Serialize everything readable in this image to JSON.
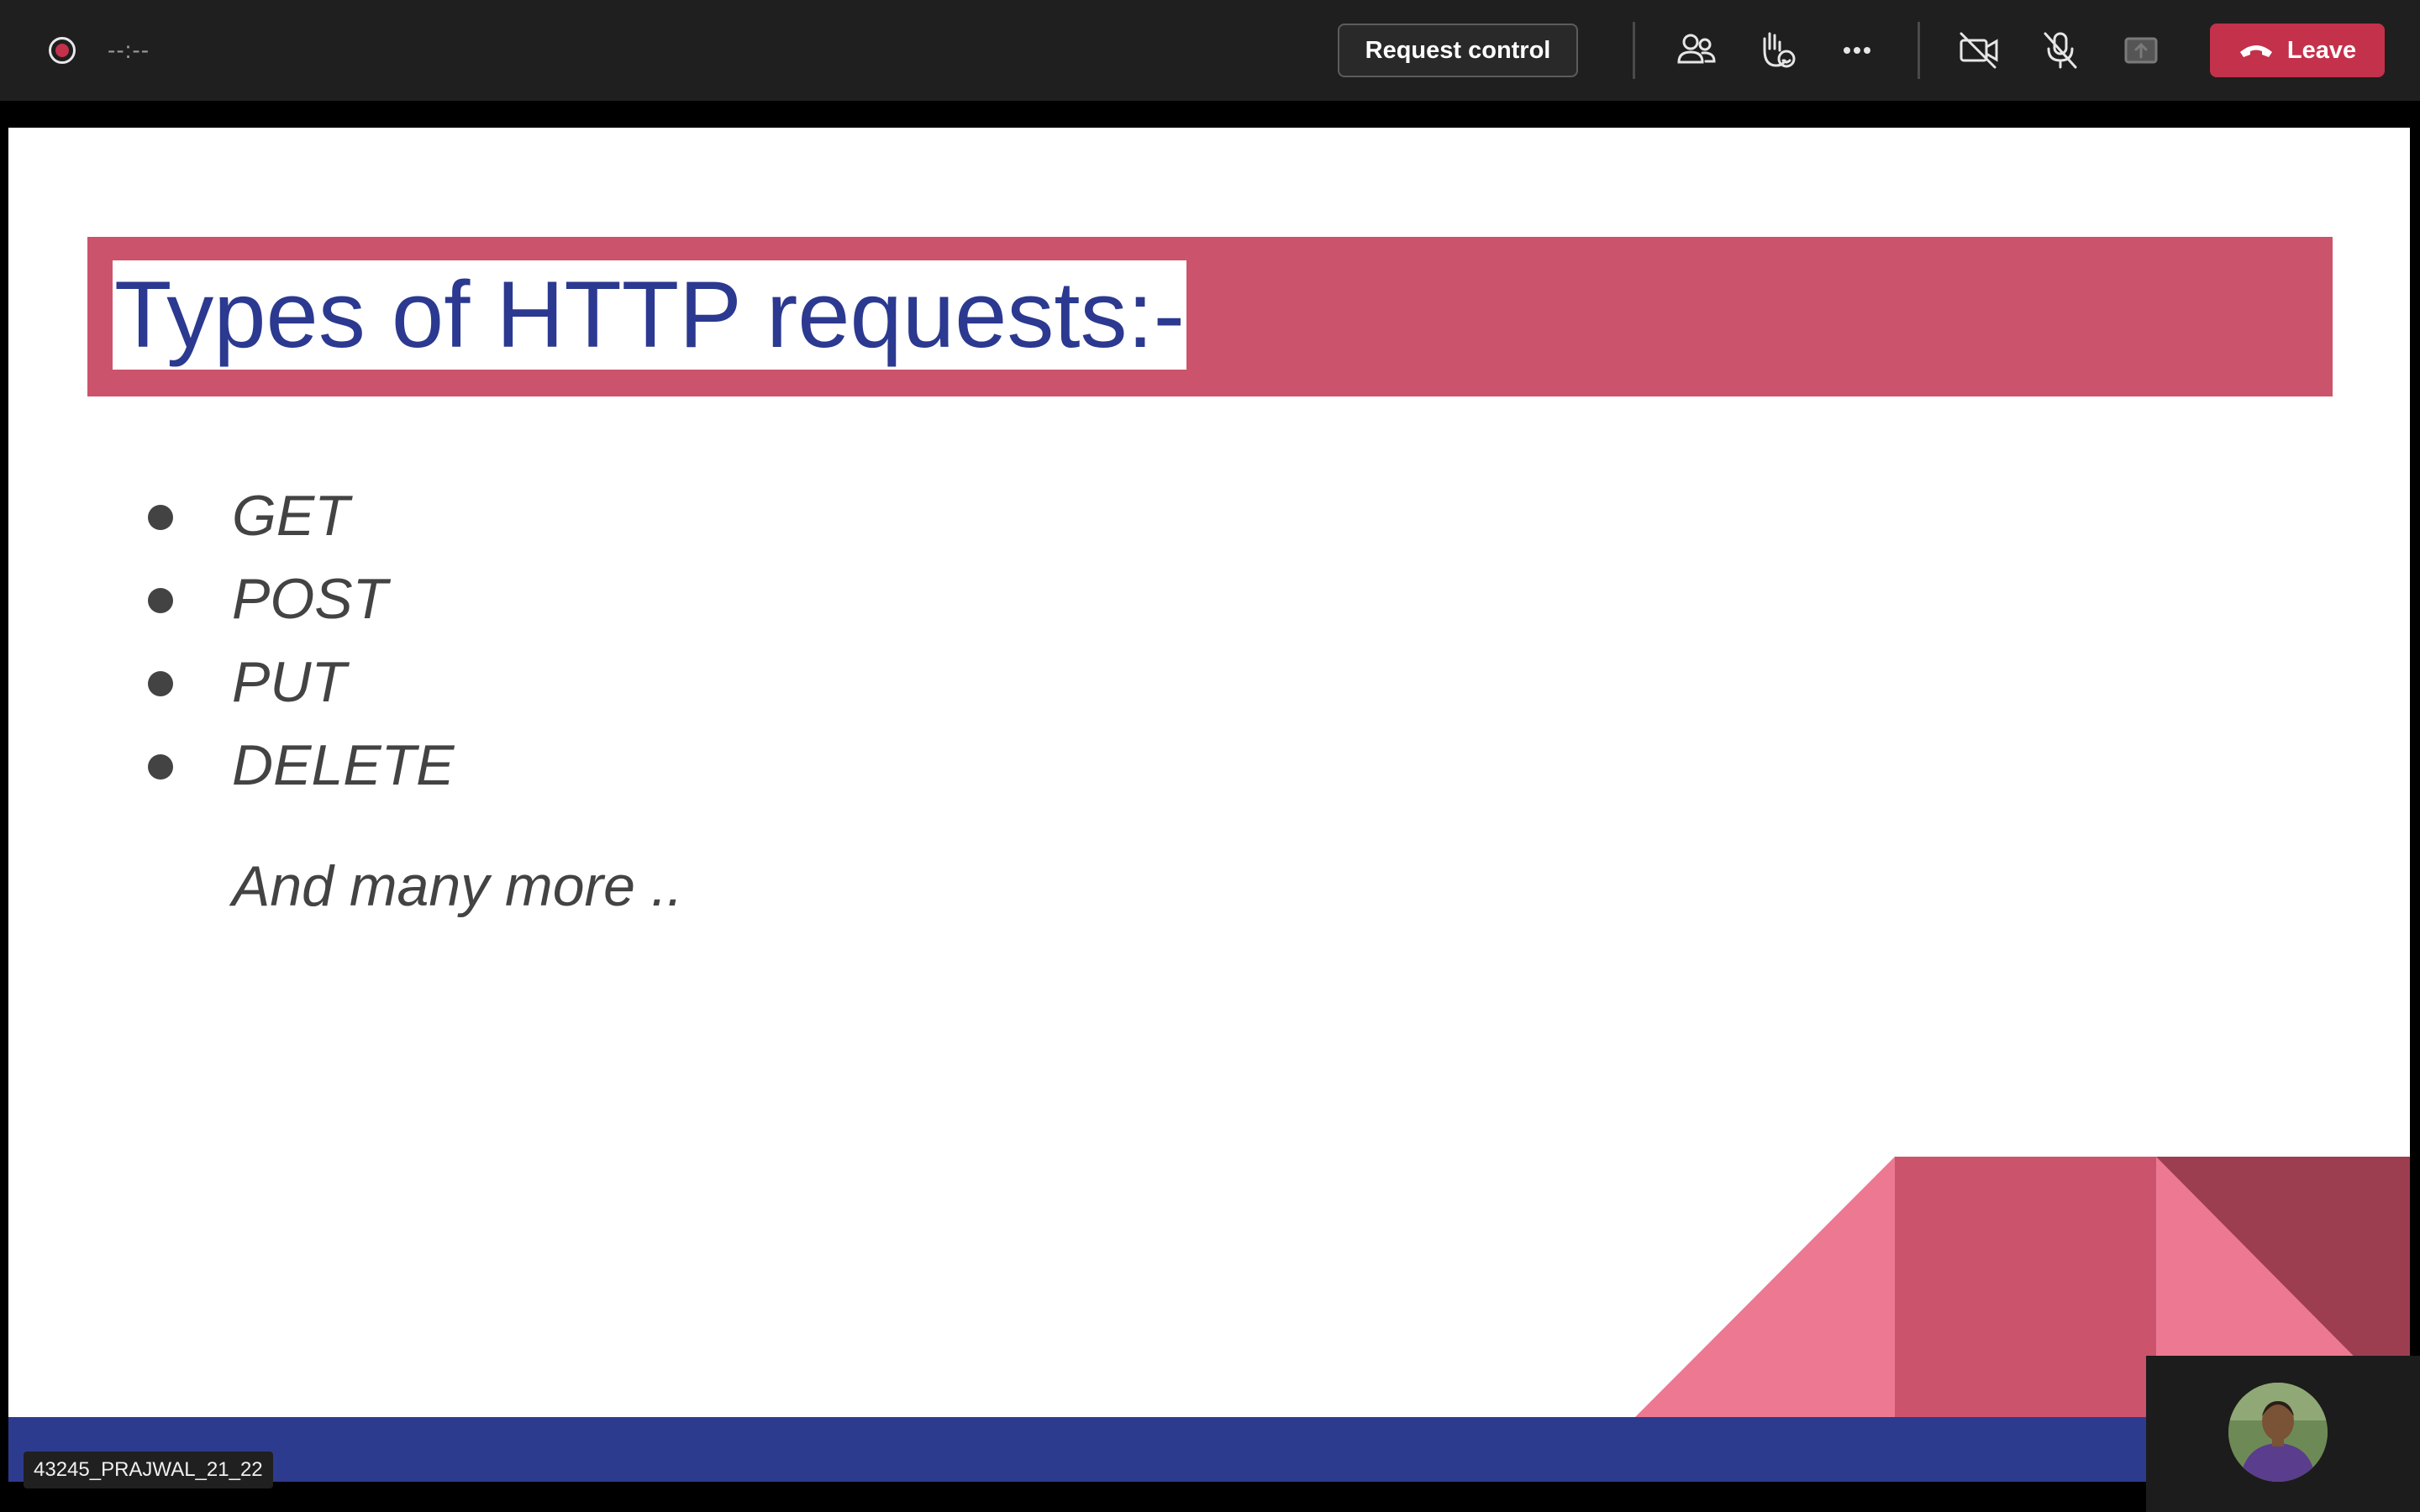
{
  "toolbar": {
    "timer": "--:--",
    "request_control_label": "Request control",
    "leave_label": "Leave",
    "icons": [
      "record-icon",
      "people-icon",
      "raise-hand-icon",
      "more-icon",
      "camera-off-icon",
      "mic-off-icon",
      "share-icon",
      "phone-icon"
    ]
  },
  "slide": {
    "title": "Types of HTTP requests:-",
    "bullets": [
      "GET",
      "POST",
      "PUT",
      "DELETE"
    ],
    "more": "And many more .."
  },
  "participant": {
    "name": "43245_PRAJWAL_21_22"
  },
  "colors": {
    "toolbar_bg": "#1f1f1f",
    "leave_button": "#c4314b",
    "title_band": "#cc536c",
    "title_text": "#2b3990",
    "bottom_band": "#2d3b8f",
    "decor_light_pink": "#ec7891",
    "decor_mid_pink": "#cc536c",
    "decor_dark_pink": "#9c3d50"
  }
}
